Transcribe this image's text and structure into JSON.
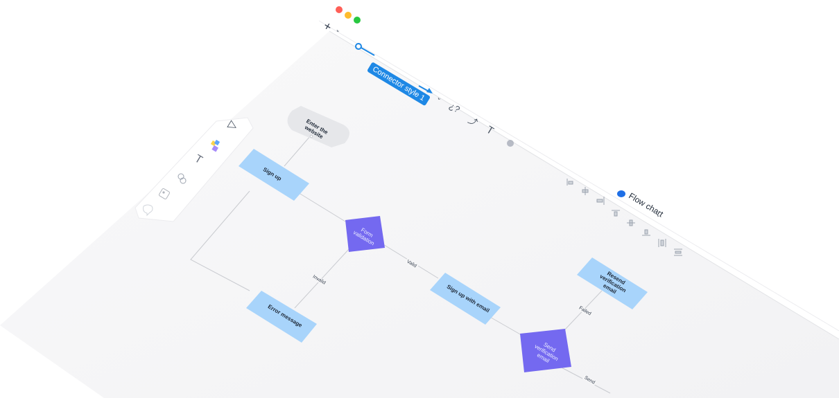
{
  "window": {
    "traffic_lights": [
      "#ff5f57",
      "#febc2e",
      "#28c840"
    ]
  },
  "toolbar": {
    "add_label": "+",
    "connector_tooltip": "Connector style 1",
    "font_tool": "T",
    "help_tool": "¿?"
  },
  "sidebar": {
    "items": [
      {
        "icon": "pointer-icon"
      },
      {
        "icon": "sticky-notes-icon"
      },
      {
        "icon": "text-icon",
        "label": "T"
      },
      {
        "icon": "shapes-icon"
      },
      {
        "icon": "image-icon"
      },
      {
        "icon": "comment-icon"
      }
    ]
  },
  "board": {
    "title": "Flow chart",
    "title_icon_color": "#1e6fe6",
    "colors": {
      "process": "#a8d4fb",
      "decision": "#7469f0",
      "start": "#e6e7ea",
      "connector": "#c9cbd0"
    },
    "nodes": {
      "enter": "Enter the website",
      "signup": "Sign up",
      "form": "Form validation",
      "error": "Error message",
      "signup_email": "Sign up with email",
      "send_verification": "Send verification email",
      "resend": "Resend verification email"
    },
    "edges": {
      "invalid": "Invalid",
      "valid": "Valid",
      "failed": "Failed",
      "send": "Send"
    }
  }
}
